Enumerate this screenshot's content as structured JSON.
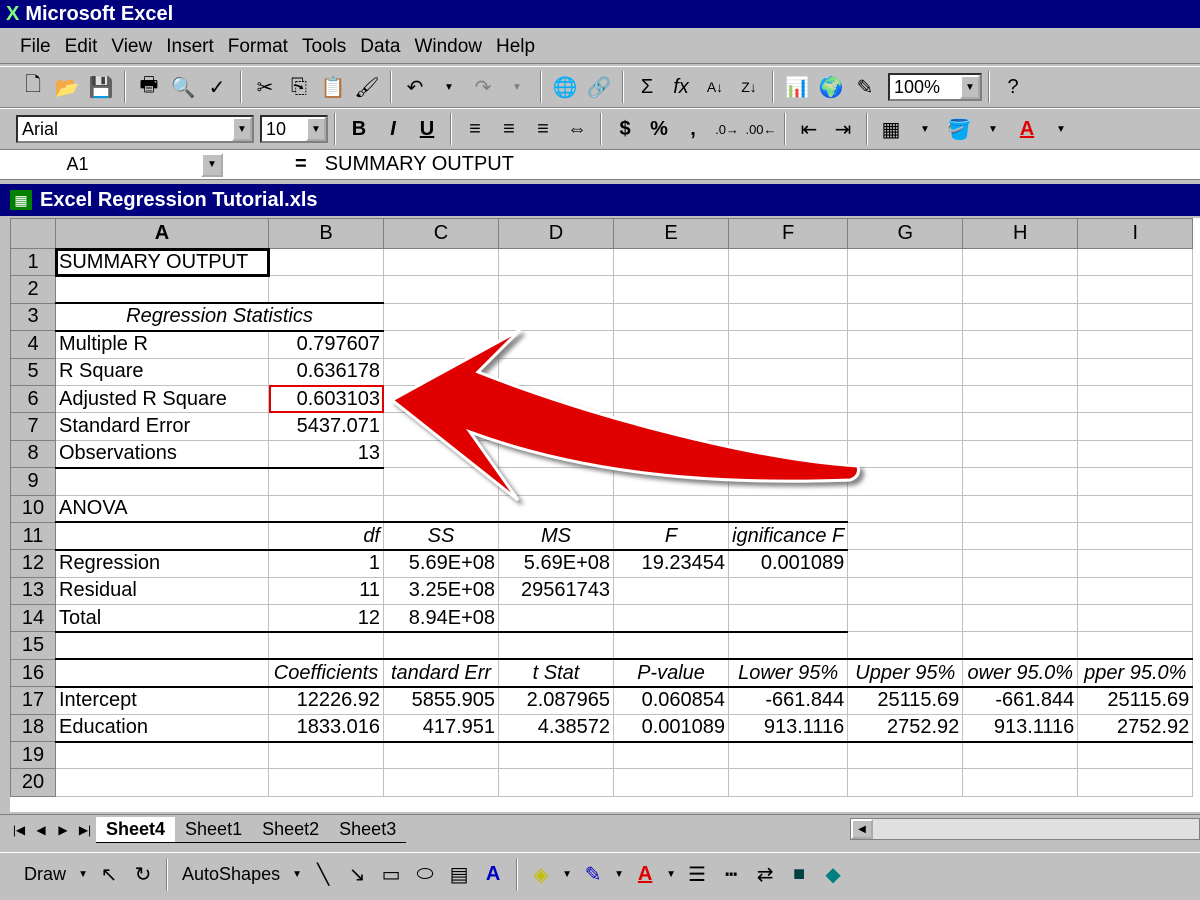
{
  "app": {
    "title": "Microsoft Excel",
    "logo_glyph": "X"
  },
  "menu": [
    "File",
    "Edit",
    "View",
    "Insert",
    "Format",
    "Tools",
    "Data",
    "Window",
    "Help"
  ],
  "standard_toolbar": {
    "zoom": "100%"
  },
  "format_toolbar": {
    "font": "Arial",
    "size": "10",
    "bold": "B",
    "italic": "I",
    "underline": "U",
    "currency": "$",
    "percent": "%",
    "comma": ","
  },
  "formula_bar": {
    "name_box": "A1",
    "equals": "=",
    "content": "SUMMARY OUTPUT"
  },
  "workbook": {
    "title": "Excel Regression Tutorial.xls"
  },
  "columns": [
    "A",
    "B",
    "C",
    "D",
    "E",
    "F",
    "G",
    "H",
    "I"
  ],
  "rows": [
    {
      "n": "1",
      "cells": [
        "SUMMARY OUTPUT",
        "",
        "",
        "",
        "",
        "",
        "",
        "",
        ""
      ]
    },
    {
      "n": "2",
      "cells": [
        "",
        "",
        "",
        "",
        "",
        "",
        "",
        "",
        ""
      ]
    },
    {
      "n": "3",
      "cells": [
        "Regression Statistics",
        "",
        "",
        "",
        "",
        "",
        "",
        "",
        ""
      ]
    },
    {
      "n": "4",
      "cells": [
        "Multiple R",
        "0.797607",
        "",
        "",
        "",
        "",
        "",
        "",
        ""
      ]
    },
    {
      "n": "5",
      "cells": [
        "R Square",
        "0.636178",
        "",
        "",
        "",
        "",
        "",
        "",
        ""
      ]
    },
    {
      "n": "6",
      "cells": [
        "Adjusted R Square",
        "0.603103",
        "",
        "",
        "",
        "",
        "",
        "",
        ""
      ]
    },
    {
      "n": "7",
      "cells": [
        "Standard Error",
        "5437.071",
        "",
        "",
        "",
        "",
        "",
        "",
        ""
      ]
    },
    {
      "n": "8",
      "cells": [
        "Observations",
        "13",
        "",
        "",
        "",
        "",
        "",
        "",
        ""
      ]
    },
    {
      "n": "9",
      "cells": [
        "",
        "",
        "",
        "",
        "",
        "",
        "",
        "",
        ""
      ]
    },
    {
      "n": "10",
      "cells": [
        "ANOVA",
        "",
        "",
        "",
        "",
        "",
        "",
        "",
        ""
      ]
    },
    {
      "n": "11",
      "cells": [
        "",
        "df",
        "SS",
        "MS",
        "F",
        "ignificance F",
        "",
        "",
        ""
      ]
    },
    {
      "n": "12",
      "cells": [
        "Regression",
        "1",
        "5.69E+08",
        "5.69E+08",
        "19.23454",
        "0.001089",
        "",
        "",
        ""
      ]
    },
    {
      "n": "13",
      "cells": [
        "Residual",
        "11",
        "3.25E+08",
        "29561743",
        "",
        "",
        "",
        "",
        ""
      ]
    },
    {
      "n": "14",
      "cells": [
        "Total",
        "12",
        "8.94E+08",
        "",
        "",
        "",
        "",
        "",
        ""
      ]
    },
    {
      "n": "15",
      "cells": [
        "",
        "",
        "",
        "",
        "",
        "",
        "",
        "",
        ""
      ]
    },
    {
      "n": "16",
      "cells": [
        "",
        "Coefficients",
        "tandard Err",
        "t Stat",
        "P-value",
        "Lower 95%",
        "Upper 95%",
        "ower 95.0%",
        "pper 95.0%"
      ]
    },
    {
      "n": "17",
      "cells": [
        "Intercept",
        "12226.92",
        "5855.905",
        "2.087965",
        "0.060854",
        "-661.844",
        "25115.69",
        "-661.844",
        "25115.69"
      ]
    },
    {
      "n": "18",
      "cells": [
        "Education",
        "1833.016",
        "417.951",
        "4.38572",
        "0.001089",
        "913.1116",
        "2752.92",
        "913.1116",
        "2752.92"
      ]
    },
    {
      "n": "19",
      "cells": [
        "",
        "",
        "",
        "",
        "",
        "",
        "",
        "",
        ""
      ]
    },
    {
      "n": "20",
      "cells": [
        "",
        "",
        "",
        "",
        "",
        "",
        "",
        "",
        ""
      ]
    }
  ],
  "sheet_tabs": [
    "Sheet4",
    "Sheet1",
    "Sheet2",
    "Sheet3"
  ],
  "draw_toolbar": {
    "draw": "Draw",
    "autoshapes": "AutoShapes"
  },
  "annotation": {
    "arrow_color": "#e00000",
    "highlight_color": "#e00000"
  }
}
